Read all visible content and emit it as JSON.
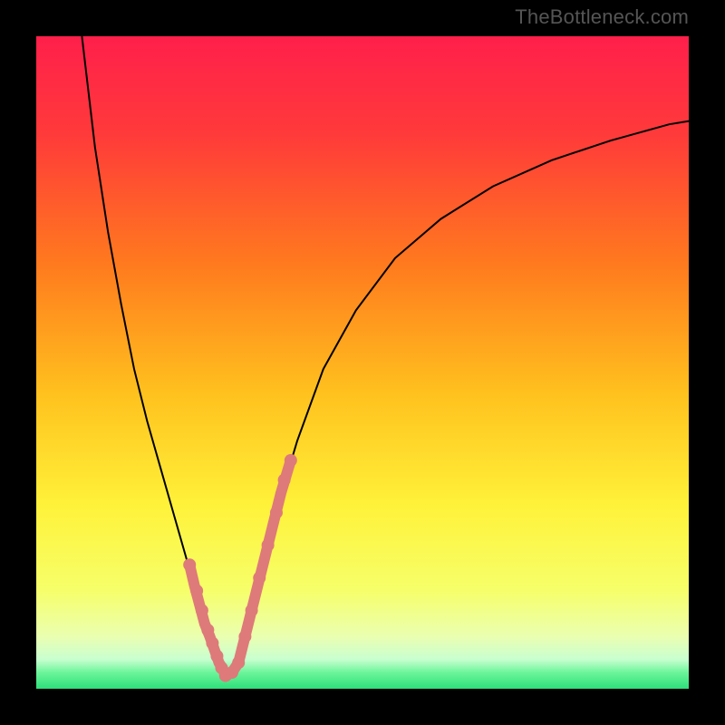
{
  "watermark": "TheBottleneck.com",
  "chart_data": {
    "type": "line",
    "title": "",
    "xlabel": "",
    "ylabel": "",
    "xlim": [
      0,
      100
    ],
    "ylim": [
      0,
      100
    ],
    "gradient_stops": [
      {
        "offset": 0.0,
        "color": "#ff1f4b"
      },
      {
        "offset": 0.15,
        "color": "#ff3a3a"
      },
      {
        "offset": 0.35,
        "color": "#ff7a1e"
      },
      {
        "offset": 0.55,
        "color": "#ffc21e"
      },
      {
        "offset": 0.72,
        "color": "#fff23a"
      },
      {
        "offset": 0.85,
        "color": "#f6ff6a"
      },
      {
        "offset": 0.92,
        "color": "#eaffb0"
      },
      {
        "offset": 0.955,
        "color": "#c8ffd0"
      },
      {
        "offset": 0.975,
        "color": "#6cf59a"
      },
      {
        "offset": 1.0,
        "color": "#2de07a"
      }
    ],
    "series": [
      {
        "name": "left-curve",
        "color": "#000000",
        "x": [
          7,
          9,
          11,
          13,
          15,
          17,
          19,
          21,
          23,
          24,
          25,
          26,
          27,
          27.5,
          28,
          28.3,
          28.6,
          29
        ],
        "y": [
          100,
          83,
          70,
          59,
          49,
          41,
          34,
          27,
          20,
          16,
          13,
          10,
          7,
          5,
          4,
          3,
          2.5,
          2
        ]
      },
      {
        "name": "right-curve",
        "color": "#000000",
        "x": [
          29,
          30,
          31,
          32,
          33,
          35,
          37,
          40,
          44,
          49,
          55,
          62,
          70,
          79,
          88,
          97,
          100
        ],
        "y": [
          2,
          3,
          5,
          8,
          12,
          20,
          28,
          38,
          49,
          58,
          66,
          72,
          77,
          81,
          84,
          86.5,
          87
        ]
      }
    ],
    "highlight": {
      "color": "#de7a7a",
      "stroke_width": 12,
      "marker_radius": 7,
      "segments": [
        {
          "name": "left-highlight",
          "x": [
            23.5,
            24.2,
            25.0,
            25.8,
            26.6,
            27.3,
            28.0,
            28.6,
            29.0
          ],
          "y": [
            19,
            16,
            13,
            10,
            8,
            6,
            4,
            3,
            2
          ]
        },
        {
          "name": "bottom-highlight",
          "x": [
            29.0,
            30.0,
            31.0
          ],
          "y": [
            2,
            2.5,
            4
          ]
        },
        {
          "name": "right-highlight",
          "x": [
            31.0,
            32.0,
            33.0,
            34.5,
            36.0,
            37.5,
            39.0
          ],
          "y": [
            4,
            8,
            12,
            18,
            24,
            30,
            35
          ]
        }
      ],
      "markers": [
        {
          "x": 23.5,
          "y": 19
        },
        {
          "x": 24.6,
          "y": 15
        },
        {
          "x": 25.4,
          "y": 12
        },
        {
          "x": 26.3,
          "y": 9
        },
        {
          "x": 27.0,
          "y": 7
        },
        {
          "x": 27.7,
          "y": 5
        },
        {
          "x": 28.4,
          "y": 3.2
        },
        {
          "x": 29.0,
          "y": 2
        },
        {
          "x": 30.0,
          "y": 2.5
        },
        {
          "x": 31.0,
          "y": 4
        },
        {
          "x": 32.0,
          "y": 8
        },
        {
          "x": 33.0,
          "y": 12
        },
        {
          "x": 34.2,
          "y": 17
        },
        {
          "x": 35.5,
          "y": 22
        },
        {
          "x": 36.8,
          "y": 27
        },
        {
          "x": 38.0,
          "y": 32
        },
        {
          "x": 39.0,
          "y": 35
        }
      ]
    }
  }
}
